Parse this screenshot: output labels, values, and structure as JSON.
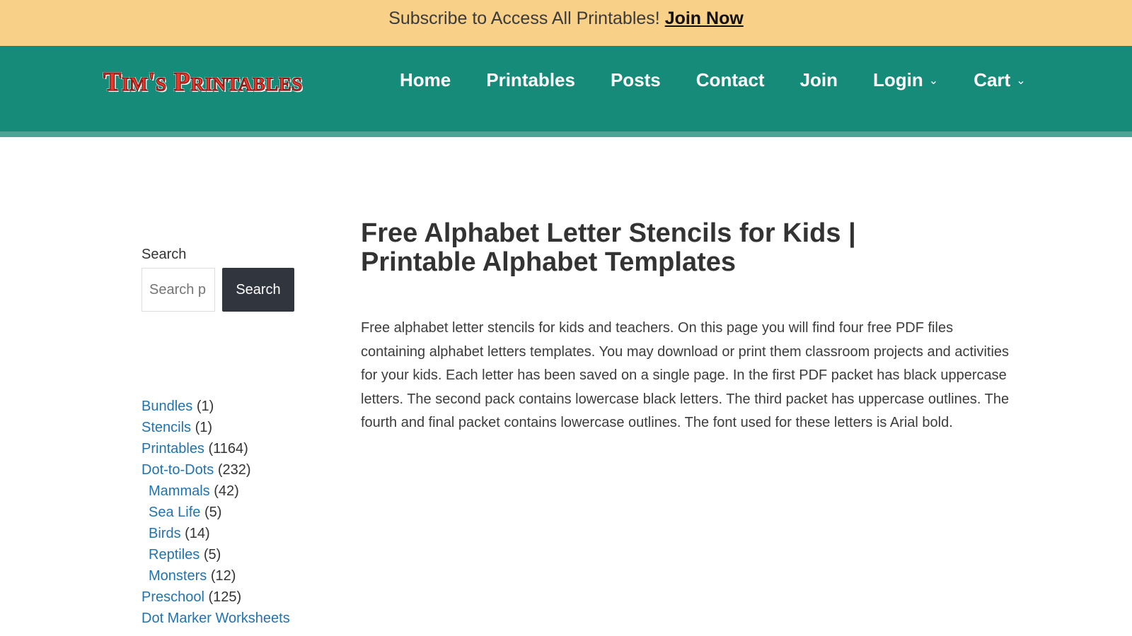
{
  "announcement": {
    "text": "Subscribe to Access All Printables!",
    "link_label": "Join Now",
    "background": "#f8d087"
  },
  "header": {
    "background": "#178b79",
    "logo_text": "Tim's Printables",
    "nav": [
      {
        "label": "Home",
        "has_dropdown": false
      },
      {
        "label": "Printables",
        "has_dropdown": false
      },
      {
        "label": "Posts",
        "has_dropdown": false
      },
      {
        "label": "Contact",
        "has_dropdown": false
      },
      {
        "label": "Join",
        "has_dropdown": false
      },
      {
        "label": "Login",
        "has_dropdown": true
      },
      {
        "label": "Cart",
        "has_dropdown": true
      }
    ],
    "dropdown_icon": "chevron-down-icon"
  },
  "sidebar": {
    "search_label": "Search",
    "search_placeholder": "Search p",
    "search_button": "Search",
    "categories": [
      {
        "name": "Bundles",
        "count": "(1)"
      },
      {
        "name": "Stencils",
        "count": "(1)"
      },
      {
        "name": "Printables",
        "count": "(1164)"
      },
      {
        "name": "Dot-to-Dots",
        "count": "(232)"
      },
      {
        "name": "Mammals",
        "count": "(42)"
      },
      {
        "name": "Sea Life",
        "count": "(5)"
      },
      {
        "name": "Birds",
        "count": "(14)"
      },
      {
        "name": "Reptiles",
        "count": "(5)"
      },
      {
        "name": "Monsters",
        "count": "(12)"
      },
      {
        "name": "Preschool",
        "count": "(125)"
      },
      {
        "name": "Dot Marker Worksheets",
        "count": ""
      }
    ],
    "link_color": "#1f73b0"
  },
  "main": {
    "title_line1": "Free Alphabet Letter Stencils for Kids |",
    "title_line2": "Printable Alphabet Templates",
    "intro": "Free alphabet letter stencils for kids and teachers. On this page you will find four free PDF files containing alphabet letters templates.  You may download or print them classroom projects and activities for your kids. Each letter has been saved on a single page. In the first PDF packet has black uppercase letters. The second pack contains lowercase black letters. The third packet has uppercase outlines. The fourth and final packet contains lowercase outlines. The font used for these letters is Arial bold."
  }
}
